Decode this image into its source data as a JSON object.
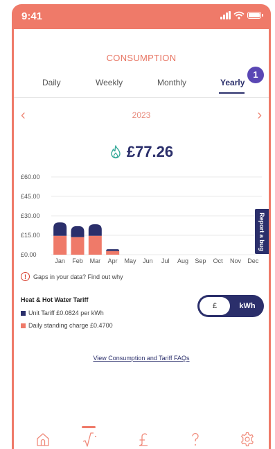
{
  "status_bar": {
    "time": "9:41"
  },
  "header": {
    "title": "CONSUMPTION"
  },
  "tabs": [
    {
      "label": "Daily"
    },
    {
      "label": "Weekly"
    },
    {
      "label": "Monthly"
    },
    {
      "label": "Yearly",
      "active": true
    }
  ],
  "badge": {
    "value": "1"
  },
  "period": {
    "year": "2023"
  },
  "summary": {
    "amount": "£77.26",
    "icon": "flame-icon"
  },
  "chart_data": {
    "type": "bar",
    "stacked": true,
    "categories": [
      "Jan",
      "Feb",
      "Mar",
      "Apr",
      "May",
      "Jun",
      "Jul",
      "Aug",
      "Sep",
      "Oct",
      "Nov",
      "Dec"
    ],
    "y_ticks": [
      "£60.00",
      "£45.00",
      "£30.00",
      "£15.00",
      "£0.00"
    ],
    "ylim": [
      0,
      60
    ],
    "grid": true,
    "series": [
      {
        "name": "Daily standing charge",
        "color": "#ef7a69",
        "values": [
          14.6,
          13.5,
          14.6,
          2.8,
          0,
          0,
          0,
          0,
          0,
          0,
          0,
          0
        ]
      },
      {
        "name": "Unit Tariff",
        "color": "#2b2f6b",
        "values": [
          10.4,
          8.5,
          8.9,
          1.4,
          0,
          0,
          0,
          0,
          0,
          0,
          0,
          0
        ]
      }
    ]
  },
  "gaps": {
    "text": "Gaps in your data? Find out why"
  },
  "tariff": {
    "title": "Heat & Hot Water Tariff",
    "unit_label": "Unit Tariff £0.0824 per kWh",
    "standing_label": "Daily standing charge £0.4700",
    "unit_color": "#2b2f6b",
    "standing_color": "#ef7a69"
  },
  "toggle": {
    "gbp_label": "£",
    "kwh_label": "kWh",
    "selected": "kWh"
  },
  "faq": {
    "label": "View Consumption and Tariff FAQs"
  },
  "report": {
    "label": "Report a bug"
  },
  "nav": [
    "home-icon",
    "consumption-icon",
    "pound-icon",
    "help-icon",
    "settings-icon"
  ]
}
